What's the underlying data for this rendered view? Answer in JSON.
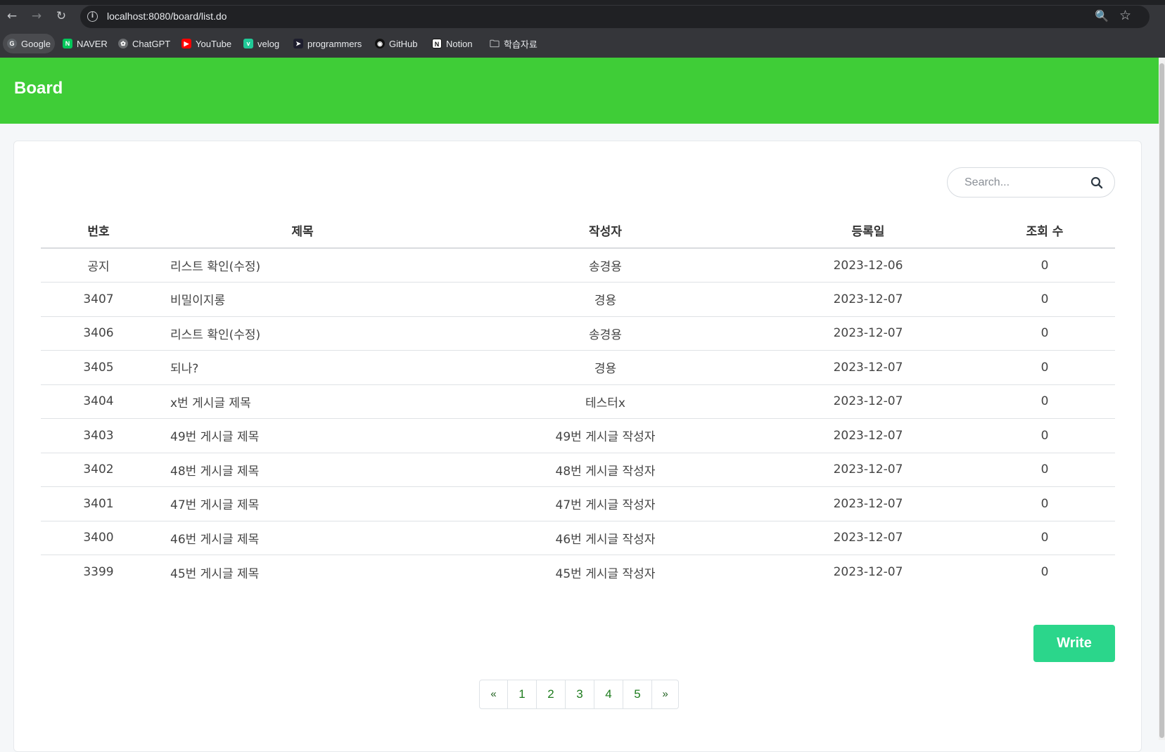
{
  "browser": {
    "url": "localhost:8080/board/list.do",
    "bookmarks": [
      {
        "label": "Google",
        "icon": "google-icon"
      },
      {
        "label": "NAVER",
        "icon": "naver-icon"
      },
      {
        "label": "ChatGPT",
        "icon": "chatgpt-icon"
      },
      {
        "label": "YouTube",
        "icon": "youtube-icon"
      },
      {
        "label": "velog",
        "icon": "velog-icon"
      },
      {
        "label": "programmers",
        "icon": "programmers-icon"
      },
      {
        "label": "GitHub",
        "icon": "github-icon"
      },
      {
        "label": "Notion",
        "icon": "notion-icon"
      },
      {
        "label": "학습자료",
        "icon": "folder-icon"
      }
    ]
  },
  "header": {
    "title": "Board",
    "color": "#3fcd37"
  },
  "search": {
    "placeholder": "Search..."
  },
  "table": {
    "columns": [
      "번호",
      "제목",
      "작성자",
      "등록일",
      "조회 수"
    ],
    "rows": [
      [
        "공지",
        "리스트 확인(수정)",
        "송경용",
        "2023-12-06",
        "0"
      ],
      [
        "3407",
        "비밀이지롱",
        "경용",
        "2023-12-07",
        "0"
      ],
      [
        "3406",
        "리스트 확인(수정)",
        "송경용",
        "2023-12-07",
        "0"
      ],
      [
        "3405",
        "되나?",
        "경용",
        "2023-12-07",
        "0"
      ],
      [
        "3404",
        "x번 게시글 제목",
        "테스터x",
        "2023-12-07",
        "0"
      ],
      [
        "3403",
        "49번 게시글 제목",
        "49번 게시글 작성자",
        "2023-12-07",
        "0"
      ],
      [
        "3402",
        "48번 게시글 제목",
        "48번 게시글 작성자",
        "2023-12-07",
        "0"
      ],
      [
        "3401",
        "47번 게시글 제목",
        "47번 게시글 작성자",
        "2023-12-07",
        "0"
      ],
      [
        "3400",
        "46번 게시글 제목",
        "46번 게시글 작성자",
        "2023-12-07",
        "0"
      ],
      [
        "3399",
        "45번 게시글 제목",
        "45번 게시글 작성자",
        "2023-12-07",
        "0"
      ]
    ]
  },
  "write_button": {
    "label": "Write",
    "color": "#2bd68b"
  },
  "pagination": {
    "prev": "«",
    "pages": [
      "1",
      "2",
      "3",
      "4",
      "5"
    ],
    "next": "»"
  }
}
